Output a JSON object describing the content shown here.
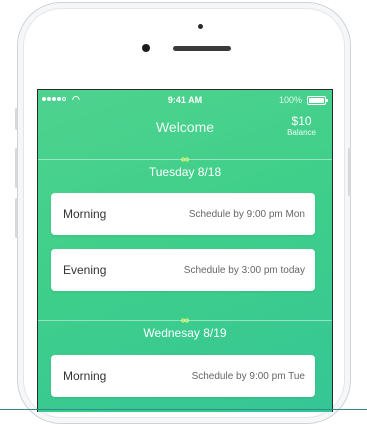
{
  "status_bar": {
    "time": "9:41 AM",
    "battery": "100%"
  },
  "header": {
    "title": "Welcome",
    "balance_amount": "$10",
    "balance_label": "Balance"
  },
  "icons": {
    "day_marker": "infinity-icon"
  },
  "days": [
    {
      "label": "Tuesday 8/18",
      "slots": [
        {
          "name": "Morning",
          "note": "Schedule by 9:00 pm Mon"
        },
        {
          "name": "Evening",
          "note": "Schedule by 3:00 pm today"
        }
      ]
    },
    {
      "label": "Wednesay 8/19",
      "slots": [
        {
          "name": "Morning",
          "note": "Schedule by 9:00 pm Tue"
        }
      ]
    }
  ]
}
